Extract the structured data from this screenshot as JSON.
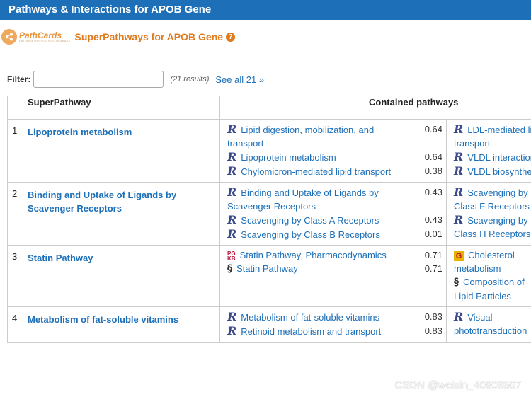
{
  "header": {
    "title": "Pathways & Interactions for APOB Gene"
  },
  "superpathways": {
    "logo_name": "PathCards",
    "logo_sub": "PATHWAY UNIFICATION DATABASE",
    "title": "SuperPathways for APOB Gene",
    "help_icon": "question-circle-icon"
  },
  "filter": {
    "label": "Filter:",
    "value": "",
    "results": "(21 results)",
    "see_all": "See all 21 »"
  },
  "table": {
    "columns": [
      "",
      "SuperPathway",
      "Contained pathways"
    ],
    "rows": [
      {
        "num": "1",
        "name": "Lipoprotein metabolism",
        "col1": [
          {
            "icon": "reactome-icon",
            "text": "Lipid digestion, mobilization, and transport",
            "score": "0.64"
          },
          {
            "icon": "reactome-icon",
            "text": "Lipoprotein metabolism",
            "score": "0.64"
          },
          {
            "icon": "reactome-icon",
            "text": "Chylomicron-mediated lipid transport",
            "score": "0.38"
          }
        ],
        "col2": [
          {
            "icon": "reactome-icon",
            "text": "LDL-mediated lipid transport"
          },
          {
            "icon": "reactome-icon",
            "text": "VLDL interaction"
          },
          {
            "icon": "reactome-icon",
            "text": "VLDL biosynthesis"
          }
        ]
      },
      {
        "num": "2",
        "name": "Binding and Uptake of Ligands by Scavenger Receptors",
        "col1": [
          {
            "icon": "reactome-icon",
            "text": "Binding and Uptake of Ligands by Scavenger Receptors",
            "score": "0.43"
          },
          {
            "icon": "reactome-icon",
            "text": "Scavenging by Class A Receptors",
            "score": "0.43"
          },
          {
            "icon": "reactome-icon",
            "text": "Scavenging by Class B Receptors",
            "score": "0.01"
          }
        ],
        "col2": [
          {
            "icon": "reactome-icon",
            "text": "Scavenging by Class F Receptors"
          },
          {
            "icon": "reactome-icon",
            "text": "Scavenging by Class H Receptors"
          }
        ]
      },
      {
        "num": "3",
        "name": "Statin Pathway",
        "col1": [
          {
            "icon": "pharmgkb-icon",
            "text": "Statin Pathway, Pharmacodynamics",
            "score": "0.71"
          },
          {
            "icon": "wikipathways-icon",
            "text": "Statin Pathway",
            "score": "0.71"
          }
        ],
        "col2": [
          {
            "icon": "gene-ontology-icon",
            "text": "Cholesterol metabolism"
          },
          {
            "icon": "wikipathways-icon",
            "text": "Composition of Lipid Particles"
          }
        ]
      },
      {
        "num": "4",
        "name": "Metabolism of fat-soluble vitamins",
        "col1": [
          {
            "icon": "reactome-icon",
            "text": "Metabolism of fat-soluble vitamins",
            "score": "0.83"
          },
          {
            "icon": "reactome-icon",
            "text": "Retinoid metabolism and transport",
            "score": "0.83"
          }
        ],
        "col2": [
          {
            "icon": "reactome-icon",
            "text": "Visual phototransduction"
          }
        ]
      }
    ]
  },
  "watermark": "CSDN @weixin_40809507"
}
